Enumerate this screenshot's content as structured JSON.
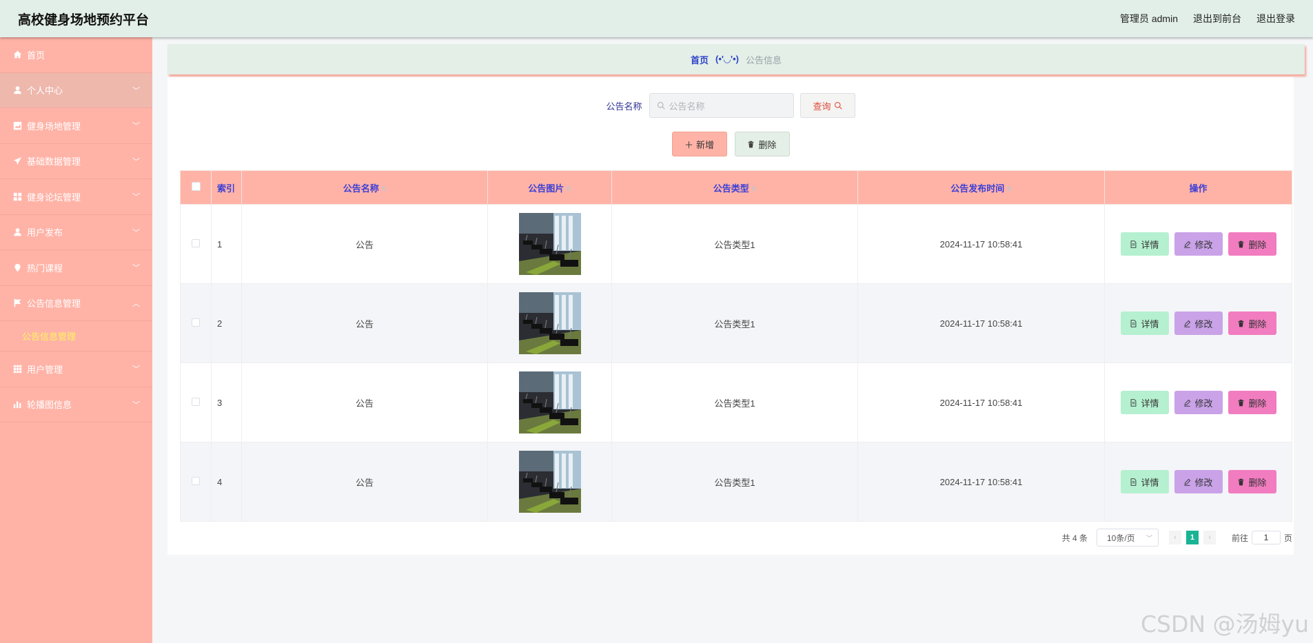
{
  "header": {
    "title": "高校健身场地预约平台",
    "admin_label": "管理员 admin",
    "front_label": "退出到前台",
    "logout_label": "退出登录"
  },
  "sidebar": {
    "items": [
      {
        "label": "首页",
        "icon": "home-icon",
        "has_arrow": false
      },
      {
        "label": "个人中心",
        "icon": "user-icon",
        "has_arrow": true,
        "arrow": "down"
      },
      {
        "label": "健身场地管理",
        "icon": "chart-icon",
        "has_arrow": true,
        "arrow": "down"
      },
      {
        "label": "基础数据管理",
        "icon": "send-icon",
        "has_arrow": true,
        "arrow": "down"
      },
      {
        "label": "健身论坛管理",
        "icon": "grid-icon",
        "has_arrow": true,
        "arrow": "down"
      },
      {
        "label": "用户发布",
        "icon": "user-icon",
        "has_arrow": true,
        "arrow": "down"
      },
      {
        "label": "热门课程",
        "icon": "location-icon",
        "has_arrow": true,
        "arrow": "down"
      },
      {
        "label": "公告信息管理",
        "icon": "flag-icon",
        "has_arrow": true,
        "arrow": "up"
      }
    ],
    "sub_item": "公告信息管理",
    "items_after": [
      {
        "label": "用户管理",
        "icon": "apps-icon",
        "arrow": "down"
      },
      {
        "label": "轮播图信息",
        "icon": "bar-chart-icon",
        "arrow": "down"
      }
    ]
  },
  "breadcrumb": {
    "home": "首页",
    "separator": "(•'◡'•)",
    "current": "公告信息"
  },
  "search": {
    "label": "公告名称",
    "placeholder": "公告名称",
    "query_label": "查询"
  },
  "actions": {
    "add_label": "新增",
    "delete_label": "删除"
  },
  "table": {
    "columns": [
      "索引",
      "公告名称",
      "公告图片",
      "公告类型",
      "公告发布时间",
      "操作"
    ],
    "rows": [
      {
        "index": "1",
        "name": "公告",
        "type": "公告类型1",
        "time": "2024-11-17 10:58:41"
      },
      {
        "index": "2",
        "name": "公告",
        "type": "公告类型1",
        "time": "2024-11-17 10:58:41"
      },
      {
        "index": "3",
        "name": "公告",
        "type": "公告类型1",
        "time": "2024-11-17 10:58:41"
      },
      {
        "index": "4",
        "name": "公告",
        "type": "公告类型1",
        "time": "2024-11-17 10:58:41"
      }
    ],
    "op_detail": "详情",
    "op_edit": "修改",
    "op_delete": "删除"
  },
  "pagination": {
    "total": "共 4 条",
    "page_size": "10条/页",
    "current_page": "1",
    "goto_prefix": "前往",
    "goto_value": "1",
    "goto_suffix": "页"
  },
  "watermark": "CSDN @汤姆yu",
  "colors": {
    "sidebar_bg": "#ffb3a7",
    "header_bg": "#e2efe8",
    "table_head_bg": "#ffb3a7",
    "detail_btn": "#b5f0d0",
    "edit_btn": "#c9a2e8",
    "delete_btn": "#f27cc0",
    "active_page": "#1ab394",
    "submenu_text": "#fff45c"
  }
}
